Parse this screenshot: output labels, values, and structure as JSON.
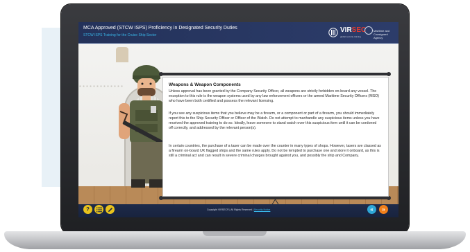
{
  "header": {
    "course_title": "MCA Approved (STCW ISPS) Proficiency in Designated Security Duties",
    "course_subtitle": "STCW ISPS Training for the Cruise Ship Sector",
    "logo_text_a": "VIR",
    "logo_text_b": "SEC",
    "logo_tagline": "global security training",
    "agency_name": "Maritime and Coastguard Agency"
  },
  "content": {
    "title": "Weapons & Weapon Components",
    "paragraphs": [
      "Unless approval has been granted by the Company Security Officer, all weapons are strictly forbidden on-board any vessel. The exception to this rule is the weapon systems used by any law enforcement officers or the armed Maritime Security Officers (MSO) who have been both certified and possess the relevant licensing.",
      "If you see any suspicious items that you believe may be a firearm, or a component or part of a firearm, you should immediately report this to the Ship Security Officer or Officer of the Watch. Do not attempt to manhandle any suspicious items unless you have received the approved training to do so. Ideally, leave someone to stand watch over this suspicious item until it can be cordoned off correctly, and addressed by the relevant person(s).",
      "In certain countries, the purchase of a taser can be made over the counter in many types of shops. However, tasers are classed as a firearm on-board UK flagged ships and the same rules apply. Do not be tempted to purchase one and store it onboard, as this is still a criminal act and can result in severe criminal charges brought against you, and possibly the ship and Company."
    ]
  },
  "footer": {
    "help_label": "?",
    "copyright": "Copyright VIRSEC® | All Rights Reserved |",
    "copyright_link": "Security Notice",
    "back_label": "«",
    "next_label": "»"
  },
  "colors": {
    "header_bg": "#24325a",
    "accent_blue": "#39b6e8",
    "help_yellow": "#e8c21c",
    "menu_green": "#9bc53d",
    "back_blue": "#2ea7d6",
    "next_orange": "#f07f1b"
  },
  "icons": [
    "virsec-logo-icon",
    "crest-icon",
    "help-icon",
    "menu-icon",
    "pencil-icon",
    "back-icon",
    "next-icon"
  ]
}
